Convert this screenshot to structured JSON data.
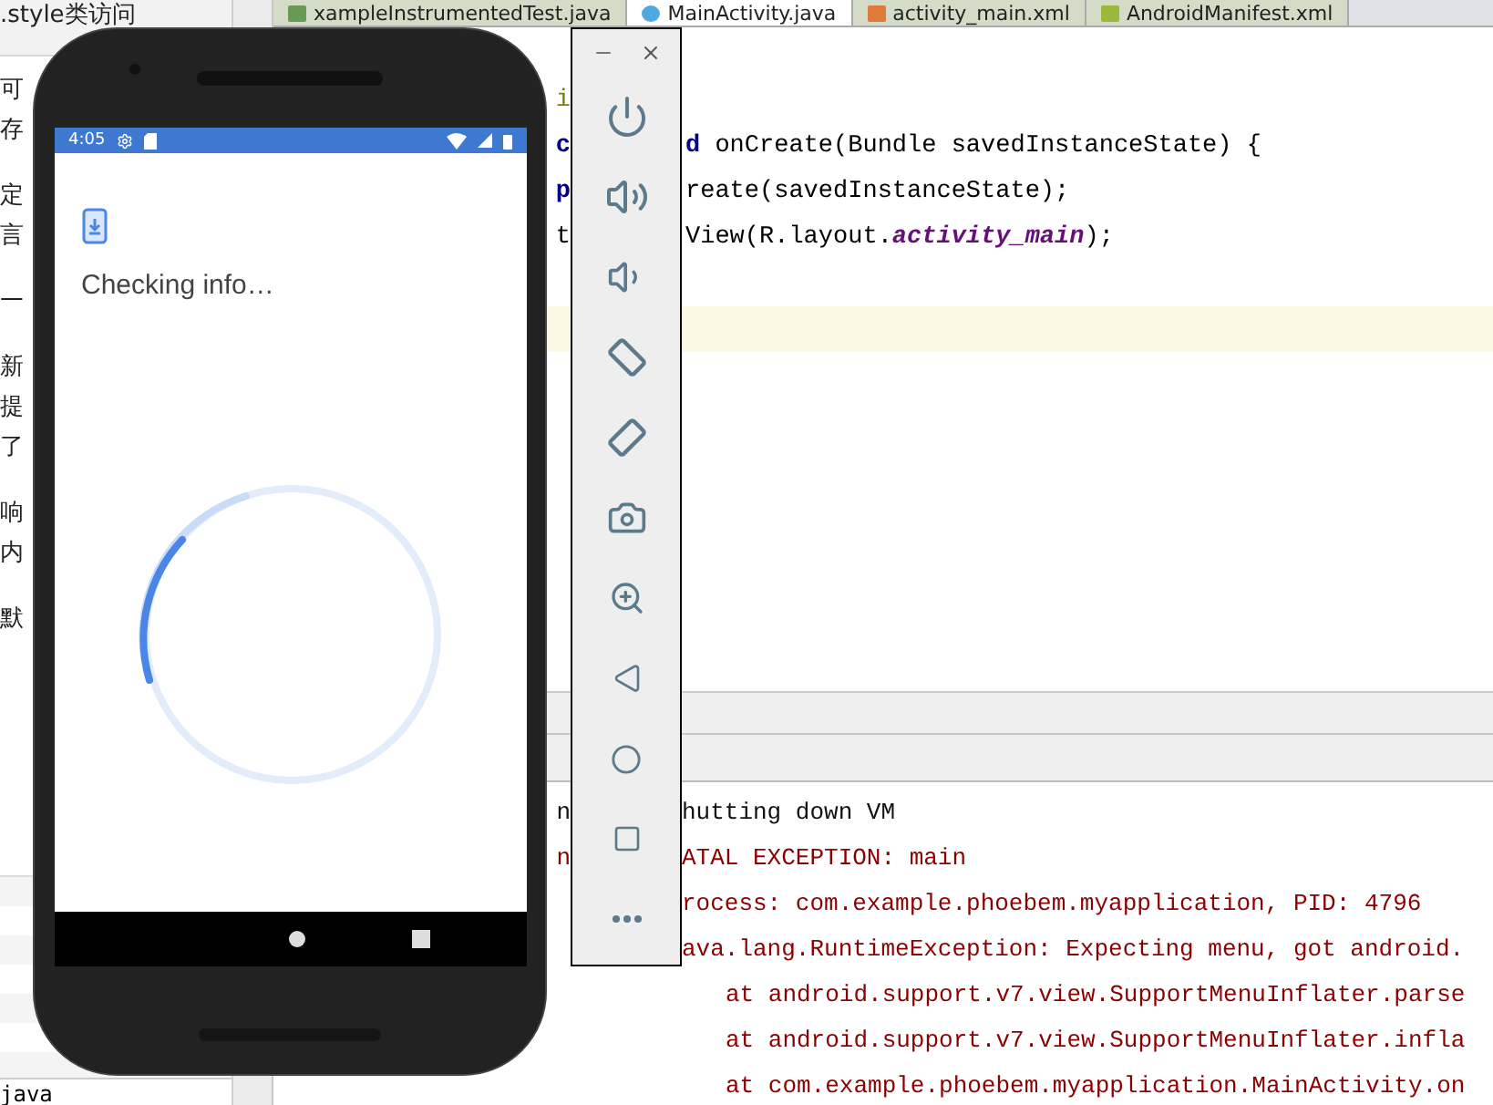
{
  "doc_panel": {
    "paragraphs": [
      [
        ".style类访问"
      ],
      [
        "可",
        "存"
      ],
      [
        "定",
        "言"
      ],
      [
        "一"
      ],
      [
        "新",
        "提",
        "了"
      ],
      [
        "响",
        "内"
      ],
      [
        "默"
      ]
    ],
    "footer": "java"
  },
  "editor": {
    "tabs": [
      {
        "label": "xampleInstrumentedTest.java",
        "kind": "test",
        "selected": false
      },
      {
        "label": "MainActivity.java",
        "kind": "class",
        "selected": true
      },
      {
        "label": "activity_main.xml",
        "kind": "layout",
        "selected": false
      },
      {
        "label": "AndroidManifest.xml",
        "kind": "manifest",
        "selected": false
      }
    ],
    "code_lines": [
      {
        "current": false,
        "left": [
          {
            "text": "i",
            "kind": "annotation"
          }
        ]
      },
      {
        "current": false,
        "left": [
          {
            "text": "c",
            "kind": "keyword"
          }
        ],
        "right": [
          {
            "text": "d",
            "kind": "keyword"
          },
          {
            "text": " onCreate(Bundle savedInstanceState) {",
            "kind": "plain"
          }
        ]
      },
      {
        "current": false,
        "left": [
          {
            "text": "p",
            "kind": "keyword"
          }
        ],
        "right": [
          {
            "text": "reate(savedInstanceState);",
            "kind": "plain"
          }
        ]
      },
      {
        "current": false,
        "left": [
          {
            "text": "t",
            "kind": "plain"
          }
        ],
        "right": [
          {
            "text": "View(R.layout.",
            "kind": "plain"
          },
          {
            "text": "activity_main",
            "kind": "field"
          },
          {
            "text": ");",
            "kind": "plain"
          }
        ]
      },
      {
        "current": false
      },
      {
        "current": true
      }
    ],
    "console_lines": [
      {
        "kind": "info",
        "left": "n",
        "right": "hutting down VM"
      },
      {
        "kind": "error",
        "left": "n",
        "right": "ATAL EXCEPTION: main"
      },
      {
        "kind": "error",
        "right": "rocess: com.example.phoebem.myapplication, PID: 4796"
      },
      {
        "kind": "error",
        "right": "ava.lang.RuntimeException: Expecting menu, got android."
      },
      {
        "kind": "stack",
        "right": "at android.support.v7.view.SupportMenuInflater.parse"
      },
      {
        "kind": "stack",
        "right": "at android.support.v7.view.SupportMenuInflater.infla"
      },
      {
        "kind": "stack",
        "right": "at com.example.phoebem.myapplication.MainActivity.on"
      }
    ]
  },
  "emulator": {
    "status_bar": {
      "time": "4:05"
    },
    "message": "Checking info…"
  }
}
